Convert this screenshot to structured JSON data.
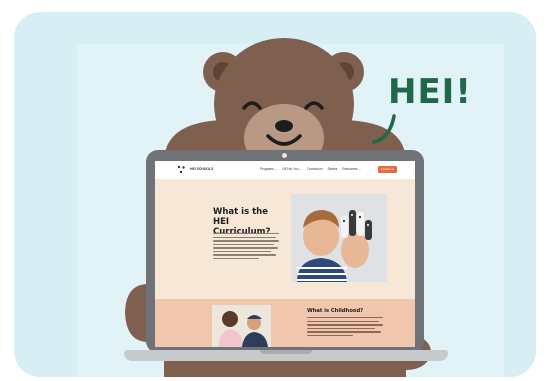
{
  "speech_bubble": {
    "text": "HEI!"
  },
  "website": {
    "logo_text": "HEI SCHOOLS",
    "nav": [
      "Programs ⌄",
      "HEI for You ⌄",
      "Curriculum",
      "Stories",
      "Resources ⌄"
    ],
    "cta_label": "Contact us",
    "hero_title": "What is the HEI Curriculum?",
    "section_title": "What is Childhood?"
  },
  "colors": {
    "card_bg": "#d6eef4",
    "accent_green": "#1f6848",
    "bear_brown": "#7f5f4e",
    "cta_orange": "#e06f3b",
    "hero_bg": "#f6e7d6",
    "section_bg": "#f0c6ad"
  }
}
